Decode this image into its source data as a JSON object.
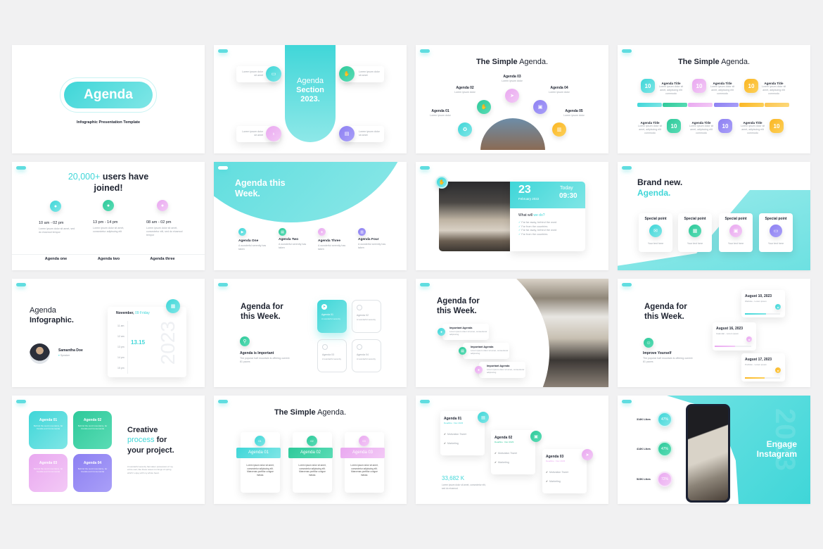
{
  "colors": {
    "teal": "#3fd6d8",
    "green": "#2ec99a",
    "pink": "#e9a8f0",
    "purple": "#8d80f2",
    "yellow": "#fbb623",
    "dark": "#1e2330"
  },
  "s1": {
    "title": "Agenda",
    "subtitle": "Infographic Presentation Template"
  },
  "s2": {
    "title": [
      "Agenda",
      "Section",
      "2023."
    ],
    "items": [
      "Lorem ipsum dolor sit amet",
      "Lorem ipsum dolor sit amet",
      "Lorem ipsum dolor sit amet",
      "Lorem ipsum dolor sit amet"
    ],
    "icons": [
      "chat-icon",
      "hand-icon",
      "medal-icon",
      "note-icon"
    ]
  },
  "s3": {
    "title_bold": "The Simple",
    "title_light": "Agenda.",
    "items": [
      {
        "label": "Agenda 01",
        "desc": "Lorem ipsum dolor"
      },
      {
        "label": "Agenda 02",
        "desc": "Lorem ipsum dolor"
      },
      {
        "label": "Agenda 03",
        "desc": "Lorem ipsum dolor"
      },
      {
        "label": "Agenda 04",
        "desc": "Lorem ipsum dolor"
      },
      {
        "label": "Agenda 05",
        "desc": "Lorem ipsum dolor"
      }
    ]
  },
  "s4": {
    "title_bold": "The Simple",
    "title_light": "Agenda.",
    "number": "10",
    "item_title": "Agenda Title",
    "item_desc": "Lorem ipsum dolor sit amet, adipiscing elit commodo"
  },
  "s5": {
    "title_accent": "20,000+",
    "title_rest": "users have",
    "title_line2": "joined!",
    "items": [
      {
        "time": "10 am - 02 pm",
        "desc": "Lorem ipsum dolor sit amet, sed do eiusmod tempor",
        "label": "Agenda one"
      },
      {
        "time": "13 pm - 14 pm",
        "desc": "Lorem ipsum dolor sit amet, consectetur adipiscing elit",
        "label": "Agenda two"
      },
      {
        "time": "08 am - 02 pm",
        "desc": "Lorem ipsum dolor sit amet, consectetur elit, sed do eiusmod tempor",
        "label": "Agenda three"
      }
    ]
  },
  "s6": {
    "title": [
      "Agenda this",
      "Week."
    ],
    "items": [
      {
        "label": "Agenda One",
        "desc": "A wonderful serenity has taken"
      },
      {
        "label": "Agenda Two",
        "desc": "A wonderful serenity has taken"
      },
      {
        "label": "Agenda Three",
        "desc": "A wonderful serenity has taken"
      },
      {
        "label": "Agenda Four",
        "desc": "A wonderful serenity has taken"
      }
    ]
  },
  "s7": {
    "day": "23",
    "month": "February 2022",
    "today": "Today",
    "time": "09:30",
    "question_a": "What will ",
    "question_b": "we do?",
    "bullets": [
      "Far far away, behind the word",
      "Far from the countries",
      "Far far away, behind the word",
      "Far from the countries"
    ]
  },
  "s8": {
    "title": "Brand new.",
    "accent": "Agenda.",
    "cards": [
      {
        "label": "Special point",
        "desc": "Your text here"
      },
      {
        "label": "Special point",
        "desc": "Your text here"
      },
      {
        "label": "Special point",
        "desc": "Your text here"
      },
      {
        "label": "Special point",
        "desc": "Your text here"
      }
    ]
  },
  "s9": {
    "title_light": "Agenda",
    "title_bold": "Infographic.",
    "name": "Samantha Doe",
    "role": "Speaker",
    "month": "November,",
    "day": "09 Friday",
    "times": [
      "11 am",
      "12 am",
      "13 pm",
      "14 pm",
      "15 pm"
    ],
    "highlight": "13.15",
    "year": "2023"
  },
  "s10": {
    "title": [
      "Agenda for",
      "this Week."
    ],
    "sub": "Agenda is Important",
    "desc": "The popular half mountain is offering current 81 paces",
    "cards": [
      {
        "label": "Agenda 01",
        "desc": "A wonderful serenity"
      },
      {
        "label": "Agenda 02",
        "desc": "A wonderful serenity"
      },
      {
        "label": "Agenda 03",
        "desc": "A wonderful serenity"
      },
      {
        "label": "Agenda 04",
        "desc": "A wonderful serenity"
      }
    ]
  },
  "s11": {
    "title": [
      "Agenda for",
      "this Week."
    ],
    "items": [
      {
        "label": "Important Agenda",
        "desc": "Lorem ipsum dolor sit amet, consectetur adipiscing"
      },
      {
        "label": "Important Agenda",
        "desc": "Lorem ipsum dolor sit amet, consectetur adipiscing"
      },
      {
        "label": "Important Agenda",
        "desc": "Lorem ipsum dolor sit amet, consectetur adipiscing"
      }
    ]
  },
  "s12": {
    "title": [
      "Agenda for",
      "this Week."
    ],
    "sub": "Improve Yourself",
    "desc": "The popular half mountain is offering current 81 paces",
    "dates": [
      {
        "date": "August 10, 2023",
        "desc": "Website - Lorem ipsum",
        "progress": 0.6
      },
      {
        "date": "August 16, 2023",
        "desc": "Calendar - Lorem ipsum",
        "progress": 0.55
      },
      {
        "date": "August 17, 2023",
        "desc": "Portfolio - Lorem ipsum",
        "progress": 0.55
      }
    ]
  },
  "s13": {
    "boxes": [
      {
        "label": "Agenda 01",
        "desc": "Behind the word mountains, far Vocalia and Consonantia"
      },
      {
        "label": "Agenda 02",
        "desc": "Behind the word mountains, far Vocalia and Consonantia"
      },
      {
        "label": "Agenda 03",
        "desc": "Behind the word mountains, far Vocalia and Consonantia"
      },
      {
        "label": "Agenda 04",
        "desc": "Behind the word mountains, far Vocalia and Consonantia"
      }
    ],
    "title_1": "Creative",
    "accent": "process",
    "title_2": " for",
    "title_3": "your project.",
    "desc": "A wonderful serenity has taken possession of my entire soul, like these sweet mornings of spring which I enjoy with my whole heart."
  },
  "s14": {
    "title_bold": "The Simple",
    "title_light": "Agenda.",
    "cards": [
      {
        "num": "01",
        "label": "Agenda 01",
        "desc": "Lorem ipsum dolor sit amet, consectetur adipiscing elit. Maecenas porttitor congue massa."
      },
      {
        "num": "02",
        "label": "Agenda 02",
        "desc": "Lorem ipsum dolor sit amet, consectetur adipiscing elit. Maecenas porttitor congue massa."
      },
      {
        "num": "03",
        "label": "Agenda 03",
        "desc": "Lorem ipsum dolor sit amet, consectetur adipiscing elit. Maecenas porttitor congue massa."
      }
    ]
  },
  "s15": {
    "cards": [
      {
        "label": "Agenda 01",
        "deadline": "Deadline : Dec 2023",
        "tasks": [
          "Motivation Tweet",
          "Marketing"
        ]
      },
      {
        "label": "Agenda 02",
        "deadline": "Deadline : Dec 2023",
        "tasks": [
          "Motivation Tweet",
          "Marketing"
        ]
      },
      {
        "label": "Agenda 03",
        "deadline": "Deadline : Dec 2023",
        "tasks": [
          "Motivation Tweet",
          "Marketing"
        ]
      }
    ],
    "stat": "33,682 K",
    "stat_desc": "Lorem ipsum dolor sit amet, consectetur elit, sed do eiusmod."
  },
  "s16": {
    "title": [
      "Engage",
      "Instagram"
    ],
    "year": "2023",
    "likes": [
      {
        "label": "314K Likes",
        "pct": "47%"
      },
      {
        "label": "414K Likes",
        "pct": "47%"
      },
      {
        "label": "523K Likes",
        "pct": "72%"
      }
    ]
  }
}
